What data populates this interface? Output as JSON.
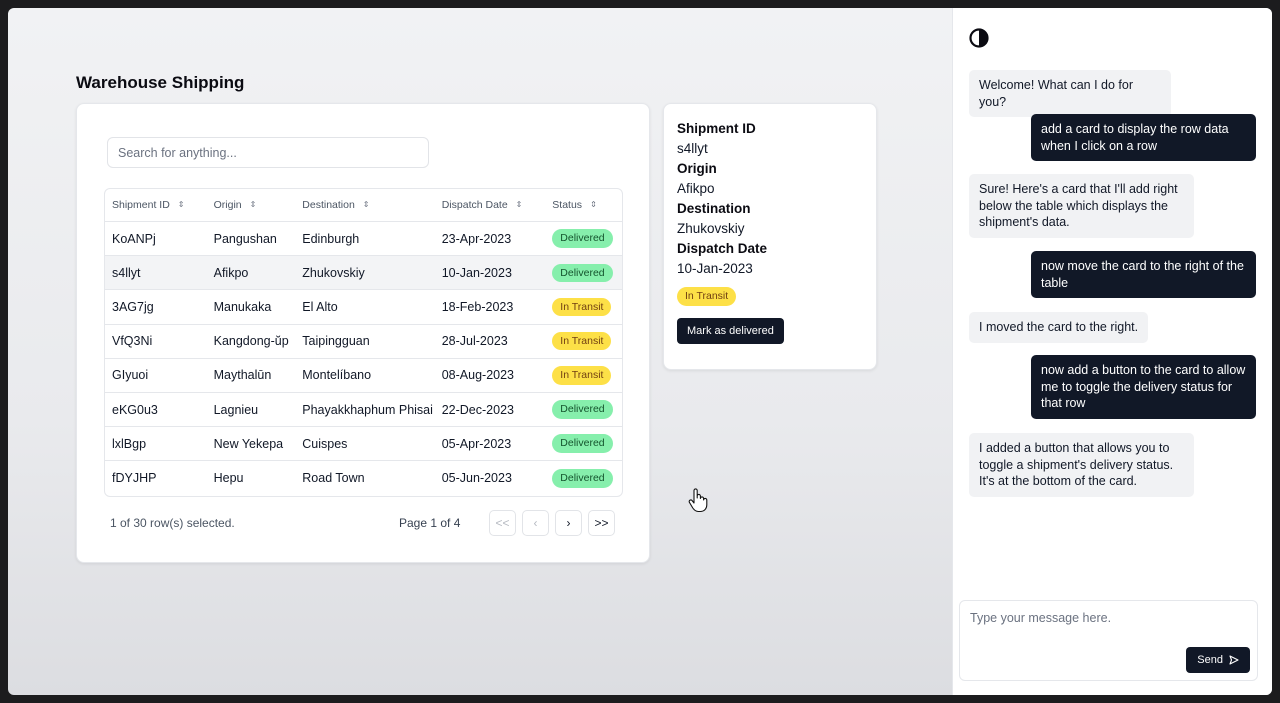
{
  "app": {
    "title": "Warehouse Shipping"
  },
  "search": {
    "placeholder": "Search for anything..."
  },
  "table": {
    "columns": [
      "Shipment ID",
      "Origin",
      "Destination",
      "Dispatch Date",
      "Status"
    ],
    "rows": [
      {
        "id": "KoANPj",
        "origin": "Pangushan",
        "destination": "Edinburgh",
        "date": "23-Apr-2023",
        "status": "Delivered"
      },
      {
        "id": "s4llyt",
        "origin": "Afikpo",
        "destination": "Zhukovskiy",
        "date": "10-Jan-2023",
        "status": "Delivered"
      },
      {
        "id": "3AG7jg",
        "origin": "Manukaka",
        "destination": "El Alto",
        "date": "18-Feb-2023",
        "status": "In Transit"
      },
      {
        "id": "VfQ3Ni",
        "origin": "Kangdong-ŭp",
        "destination": "Taipingguan",
        "date": "28-Jul-2023",
        "status": "In Transit"
      },
      {
        "id": "GIyuoi",
        "origin": "Maythalūn",
        "destination": "Montelíbano",
        "date": "08-Aug-2023",
        "status": "In Transit"
      },
      {
        "id": "eKG0u3",
        "origin": "Lagnieu",
        "destination": "Phayakkhaphum Phisai",
        "date": "22-Dec-2023",
        "status": "Delivered"
      },
      {
        "id": "lxlBgp",
        "origin": "New Yekepa",
        "destination": "Cuispes",
        "date": "05-Apr-2023",
        "status": "Delivered"
      },
      {
        "id": "fDYJHP",
        "origin": "Hepu",
        "destination": "Road Town",
        "date": "05-Jun-2023",
        "status": "Delivered"
      }
    ],
    "selected_row_index": 1,
    "selection_text": "1 of 30 row(s) selected.",
    "page_text": "Page 1 of 4",
    "pagination": {
      "first": "<<",
      "prev": "‹",
      "next": "›",
      "last": ">>"
    }
  },
  "detail": {
    "id_label": "Shipment ID",
    "id_value": "s4llyt",
    "origin_label": "Origin",
    "origin_value": "Afikpo",
    "destination_label": "Destination",
    "destination_value": "Zhukovskiy",
    "date_label": "Dispatch Date",
    "date_value": "10-Jan-2023",
    "status": "In Transit",
    "button_label": "Mark as delivered"
  },
  "chat": {
    "messages": [
      {
        "role": "ai",
        "text": "Welcome! What can I do for you?"
      },
      {
        "role": "user",
        "text": "add a card to display the row data when I click on a row"
      },
      {
        "role": "ai",
        "text": "Sure! Here's a card that I'll add right below the table which displays the shipment's data."
      },
      {
        "role": "user",
        "text": "now move the card to the right of the table"
      },
      {
        "role": "ai",
        "text": "I moved the card to the right."
      },
      {
        "role": "user",
        "text": "now add a button to the card to allow me to toggle the delivery status for that row"
      },
      {
        "role": "ai",
        "text": "I added a button that allows you to toggle a shipment's delivery status. It's at the bottom of the card."
      }
    ],
    "input_placeholder": "Type your message here.",
    "send_label": "Send"
  },
  "colors": {
    "delivered": "#86efac",
    "in_transit": "#fde047",
    "primary": "#111827"
  }
}
